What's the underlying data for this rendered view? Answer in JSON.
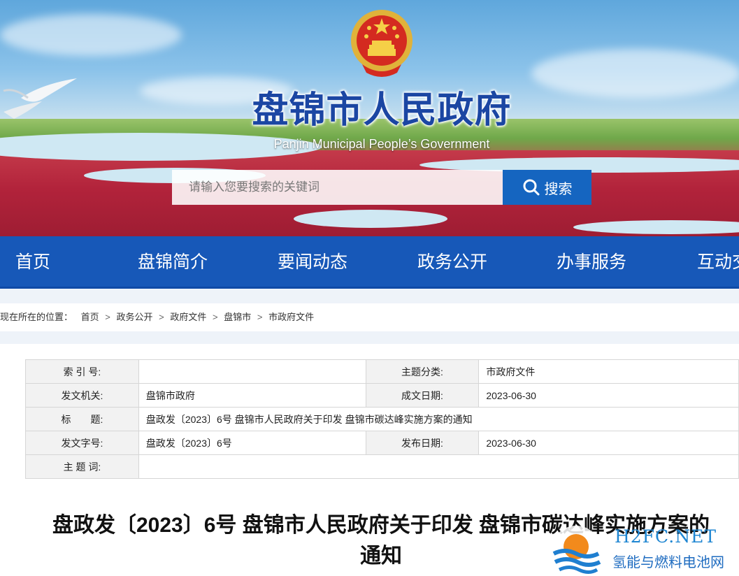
{
  "header": {
    "site_title": "盘锦市人民政府",
    "site_subtitle": "Panjin Municipal People’s Government",
    "search_placeholder": "请输入您要搜索的关键词",
    "search_button": "搜索"
  },
  "nav": {
    "items": [
      "首页",
      "盘锦简介",
      "要闻动态",
      "政务公开",
      "办事服务",
      "互动交"
    ]
  },
  "breadcrumb": {
    "prefix": "现在所在的位置：",
    "items": [
      "首页",
      "政务公开",
      "政府文件",
      "盘锦市",
      "市政府文件"
    ],
    "separator": ">"
  },
  "meta": {
    "index_label": "索 引 号:",
    "index_value": "",
    "category_label": "主题分类:",
    "category_value": "市政府文件",
    "issuer_label": "发文机关:",
    "issuer_value": "盘锦市政府",
    "written_date_label": "成文日期:",
    "written_date_value": "2023-06-30",
    "title_label": "标　　题:",
    "title_value": "盘政发〔2023〕6号 盘锦市人民政府关于印发 盘锦市碳达峰实施方案的通知",
    "doc_number_label": "发文字号:",
    "doc_number_value": "盘政发〔2023〕6号",
    "publish_date_label": "发布日期:",
    "publish_date_value": "2023-06-30",
    "keywords_label": "主 题 词:",
    "keywords_value": ""
  },
  "article": {
    "title_line1": "盘政发〔2023〕6号 盘锦市人民政府关于印发 盘锦市碳达峰实施方案的",
    "title_line2": "通知"
  },
  "watermark": {
    "brand": "H2FC.NET",
    "subtitle": "氢能与燃料电池网"
  },
  "colors": {
    "nav": "#1758b8",
    "search_button": "#1565c0",
    "title_blue": "#1b46a3"
  }
}
